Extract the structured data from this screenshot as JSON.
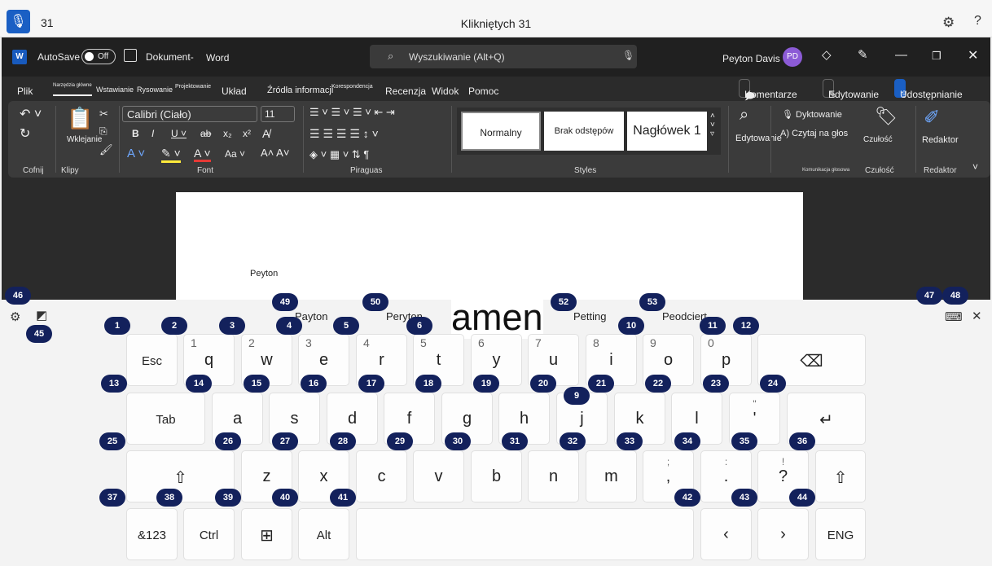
{
  "voice_bar": {
    "mic_icon": "microphone-icon",
    "count": "31",
    "title": "Klikniętych 31",
    "settings_icon": "gear-icon",
    "help_label": "?"
  },
  "word": {
    "autosave_label": "AutoSave",
    "autosave_state": "Off",
    "doc_name": "Dokument-",
    "app_name": "Word",
    "search_placeholder": "Wyszukiwanie (Alt+Q)",
    "user_name": "Peyton Davis",
    "user_initials": "PD",
    "tabs": [
      "Plik",
      "Narzędzia główne",
      "Wstawianie",
      "Rysowanie",
      "Projektowanie",
      "Układ",
      "Źródła informacji",
      "Korespondencja",
      "Recenzja",
      "Widok",
      "Pomoc"
    ],
    "comments_label": "Komentarze",
    "editing_label": "Edytowanie",
    "share_label": "Udostępnianie",
    "ribbon": {
      "undo_group": "Cofnij",
      "paste_label": "Wklejanie",
      "clipboard_group": "Klipy",
      "font_name": "Calibri (Ciało)",
      "font_size": "11",
      "font_group": "Font",
      "paragraph_group": "Piraguas",
      "style_normal": "Normalny",
      "style_nospacing": "Brak odstępów",
      "style_heading": "Nagłówek 1",
      "styles_group": "Styles",
      "editing_btn": "Edytowanie",
      "dictate_label": "Dyktowanie",
      "read_aloud_label": "Czytaj na głos",
      "voice_group": "Komunikacja głosowa",
      "sensitivity_label": "Czułość",
      "sensitivity_group": "Czułość",
      "editor_label": "Redaktor",
      "editor_group": "Redaktor"
    },
    "doc_text": "Peyton"
  },
  "keyboard": {
    "suggestions": [
      "Payton",
      "Peryton",
      "Petting",
      "Peodciert"
    ],
    "current_word": "amen",
    "row1": [
      {
        "label": "Esc",
        "hint": ""
      },
      {
        "label": "q",
        "hint": "1"
      },
      {
        "label": "w",
        "hint": "2"
      },
      {
        "label": "e",
        "hint": "3"
      },
      {
        "label": "r",
        "hint": "4"
      },
      {
        "label": "t",
        "hint": "5"
      },
      {
        "label": "y",
        "hint": "6"
      },
      {
        "label": "u",
        "hint": "7"
      },
      {
        "label": "i",
        "hint": "8"
      },
      {
        "label": "o",
        "hint": "9"
      },
      {
        "label": "p",
        "hint": "0"
      }
    ],
    "row2": [
      "Tab",
      "a",
      "s",
      "d",
      "f",
      "g",
      "h",
      "j",
      "k",
      "l"
    ],
    "row2_punct": {
      "top": "\"",
      "main": "'"
    },
    "row3": [
      "z",
      "x",
      "c",
      "v",
      "b",
      "n",
      "m"
    ],
    "row3_punct": [
      {
        "top": ";",
        "main": ","
      },
      {
        "top": ":",
        "main": "."
      },
      {
        "top": "!",
        "main": "?"
      }
    ],
    "row4": {
      "sym": "&123",
      "ctrl": "Ctrl",
      "alt": "Alt",
      "lang": "ENG",
      "left": "‹",
      "right": "›"
    },
    "icons": {
      "backspace": "⌫",
      "enter": "↵",
      "shift": "⇧",
      "windows": "⊞",
      "close": "✕"
    }
  },
  "badges": [
    "1",
    "2",
    "3",
    "4",
    "5",
    "6",
    "9",
    "10",
    "11",
    "12",
    "13",
    "14",
    "15",
    "16",
    "17",
    "18",
    "19",
    "20",
    "21",
    "22",
    "23",
    "24",
    "25",
    "26",
    "27",
    "28",
    "29",
    "30",
    "31",
    "32",
    "33",
    "34",
    "35",
    "36",
    "37",
    "38",
    "39",
    "40",
    "41",
    "42",
    "43",
    "44",
    "45",
    "46",
    "47",
    "48",
    "49",
    "50",
    "52",
    "53"
  ]
}
